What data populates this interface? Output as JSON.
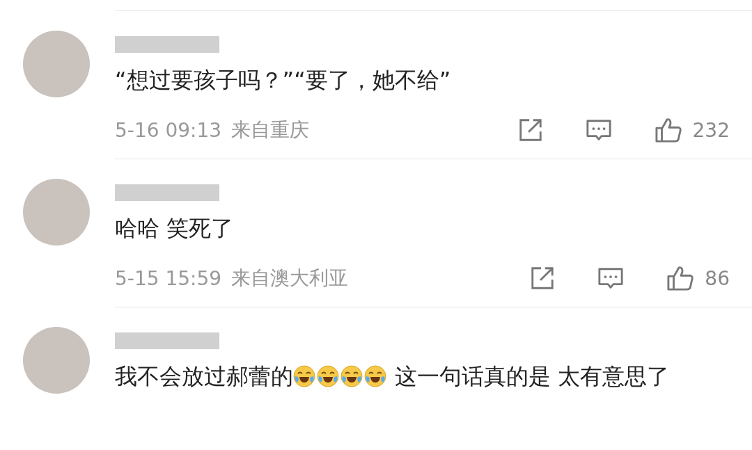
{
  "comments": [
    {
      "segments": [
        {
          "kind": "text",
          "text": "“想过要孩子吗？”“要了，她不给”"
        }
      ],
      "time": "5-16 09:13",
      "location": "来自重庆",
      "likes": "232"
    },
    {
      "segments": [
        {
          "kind": "text",
          "text": "哈哈 笑死了"
        }
      ],
      "time": "5-15 15:59",
      "location": "来自澳大利亚",
      "likes": "86"
    },
    {
      "segments": [
        {
          "kind": "text",
          "text": "我不会放过郝蕾的"
        },
        {
          "kind": "emoji"
        },
        {
          "kind": "emoji"
        },
        {
          "kind": "emoji"
        },
        {
          "kind": "emoji"
        },
        {
          "kind": "text",
          "text": " 这一句话真的是 太有意思了"
        }
      ]
    }
  ]
}
